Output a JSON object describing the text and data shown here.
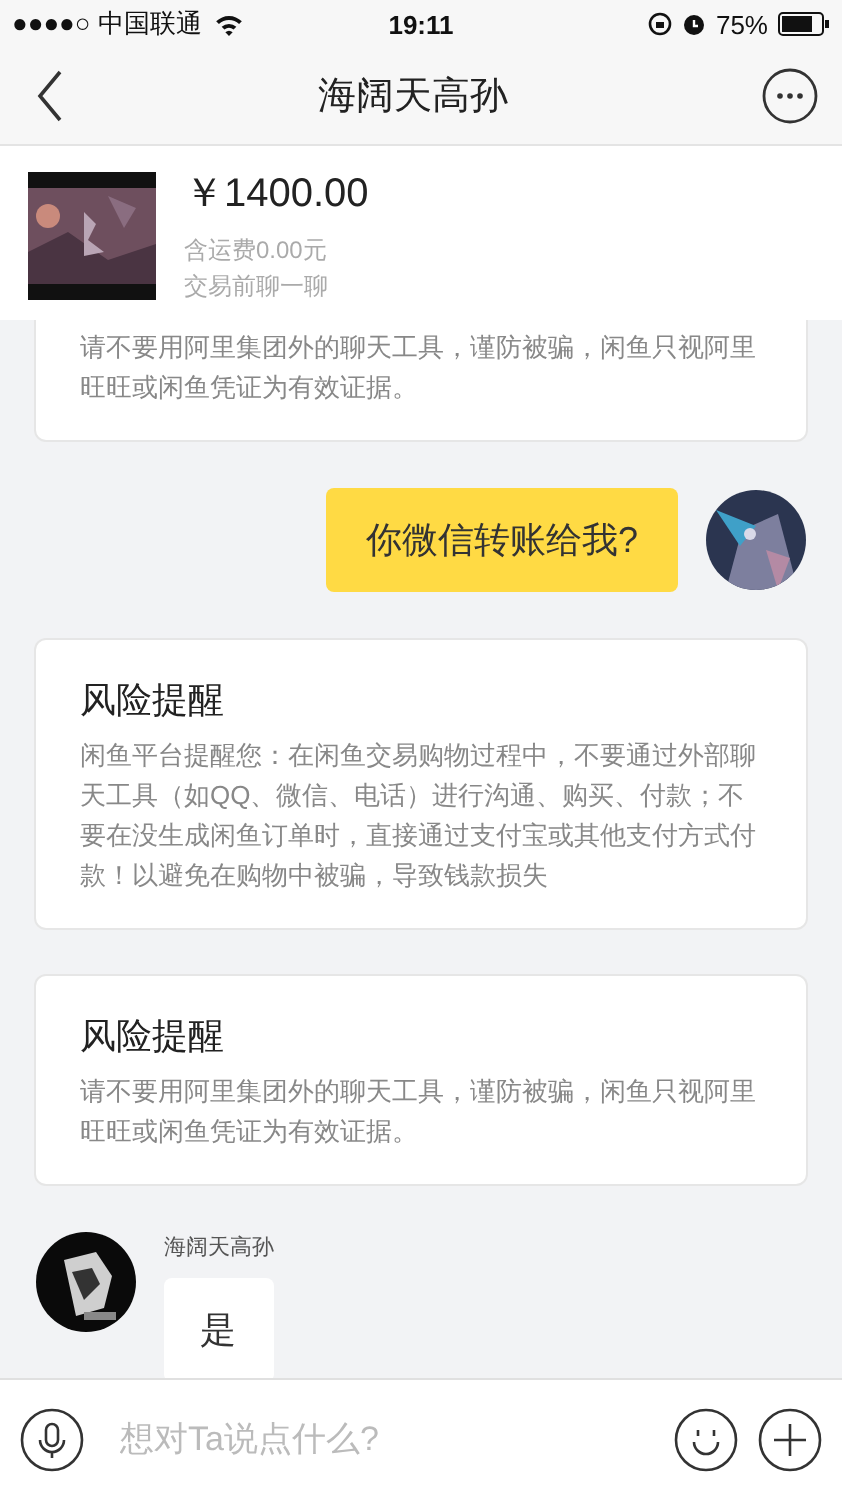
{
  "status_bar": {
    "carrier": "●●●●○ 中国联通",
    "time": "19:11",
    "battery": "75%"
  },
  "nav": {
    "title": "海阔天高孙"
  },
  "product": {
    "price": "￥1400.00",
    "shipping": "含运费0.00元",
    "note": "交易前聊一聊"
  },
  "messages": [
    {
      "kind": "notice",
      "text": "请不要用阿里集团外的聊天工具，谨防被骗，闲鱼只视阿里旺旺或闲鱼凭证为有效证据。"
    },
    {
      "kind": "outgoing",
      "text": "你微信转账给我?"
    },
    {
      "kind": "notice",
      "title": "风险提醒",
      "text": "闲鱼平台提醒您：在闲鱼交易购物过程中，不要通过外部聊天工具（如QQ、微信、电话）进行沟通、购买、付款；不要在没生成闲鱼订单时，直接通过支付宝或其他支付方式付款！以避免在购物中被骗，导致钱款损失"
    },
    {
      "kind": "notice",
      "title": "风险提醒",
      "text": "请不要用阿里集团外的聊天工具，谨防被骗，闲鱼只视阿里旺旺或闲鱼凭证为有效证据。"
    },
    {
      "kind": "incoming",
      "sender": "海阔天高孙",
      "text": "是"
    }
  ],
  "input": {
    "placeholder": "想对Ta说点什么?"
  }
}
